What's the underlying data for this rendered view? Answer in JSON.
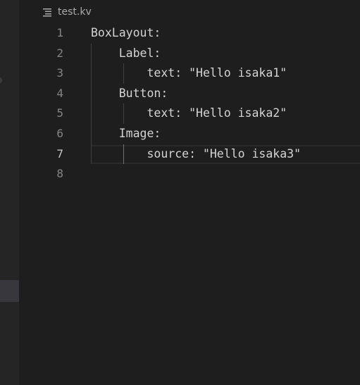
{
  "breadcrumb": {
    "file_icon": "lines-file-icon",
    "file_name": "test.kv"
  },
  "editor": {
    "current_line": 7,
    "lines": [
      {
        "number": "1",
        "text": "BoxLayout:"
      },
      {
        "number": "2",
        "text": "    Label:"
      },
      {
        "number": "3",
        "text": "        text: \"Hello isaka1\""
      },
      {
        "number": "4",
        "text": "    Button:"
      },
      {
        "number": "5",
        "text": "        text: \"Hello isaka2\""
      },
      {
        "number": "6",
        "text": "    Image:"
      },
      {
        "number": "7",
        "text": "        source: \"Hello isaka3\""
      },
      {
        "number": "8",
        "text": ""
      }
    ]
  },
  "colors": {
    "editor_background": "#1e1e1e",
    "activity_bar": "#252526",
    "text": "#d4d4d4",
    "line_number": "#858585",
    "current_line_number": "#c6c6c6"
  }
}
